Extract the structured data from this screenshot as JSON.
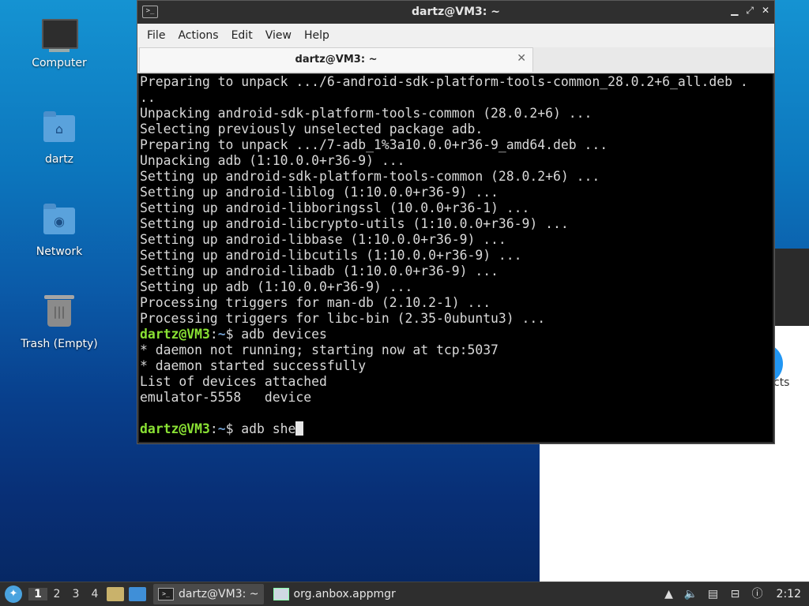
{
  "desktop": {
    "icons": [
      {
        "label": "Computer",
        "icon": "computer-icon"
      },
      {
        "label": "dartz",
        "icon": "home-folder-icon"
      },
      {
        "label": "Network",
        "icon": "network-folder-icon"
      },
      {
        "label": "Trash (Empty)",
        "icon": "trash-icon"
      }
    ]
  },
  "background_app": {
    "clipped_text": "cts"
  },
  "terminal": {
    "window_title": "dartz@VM3: ~",
    "menu": [
      "File",
      "Actions",
      "Edit",
      "View",
      "Help"
    ],
    "tab_title": "dartz@VM3: ~",
    "prompt_user": "dartz@VM3",
    "prompt_path": "~",
    "output_lines": [
      "Preparing to unpack .../6-android-sdk-platform-tools-common_28.0.2+6_all.deb .",
      "..",
      "Unpacking android-sdk-platform-tools-common (28.0.2+6) ...",
      "Selecting previously unselected package adb.",
      "Preparing to unpack .../7-adb_1%3a10.0.0+r36-9_amd64.deb ...",
      "Unpacking adb (1:10.0.0+r36-9) ...",
      "Setting up android-sdk-platform-tools-common (28.0.2+6) ...",
      "Setting up android-liblog (1:10.0.0+r36-9) ...",
      "Setting up android-libboringssl (10.0.0+r36-1) ...",
      "Setting up android-libcrypto-utils (1:10.0.0+r36-9) ...",
      "Setting up android-libbase (1:10.0.0+r36-9) ...",
      "Setting up android-libcutils (1:10.0.0+r36-9) ...",
      "Setting up android-libadb (1:10.0.0+r36-9) ...",
      "Setting up adb (1:10.0.0+r36-9) ...",
      "Processing triggers for man-db (2.10.2-1) ...",
      "Processing triggers for libc-bin (2.35-0ubuntu3) ..."
    ],
    "cmd1": "adb devices",
    "after_lines": [
      "* daemon not running; starting now at tcp:5037",
      "* daemon started successfully",
      "List of devices attached",
      "emulator-5558   device",
      ""
    ],
    "cmd2": "adb she"
  },
  "taskbar": {
    "workspaces": [
      "1",
      "2",
      "3",
      "4"
    ],
    "active_workspace": "1",
    "tasks": [
      {
        "label": "dartz@VM3: ~",
        "active": true
      },
      {
        "label": "org.anbox.appmgr",
        "active": false
      }
    ],
    "clock": "2:12"
  },
  "colors": {
    "prompt_user": "#8ae234",
    "prompt_path": "#729fcf",
    "terminal_bg": "#000000"
  }
}
